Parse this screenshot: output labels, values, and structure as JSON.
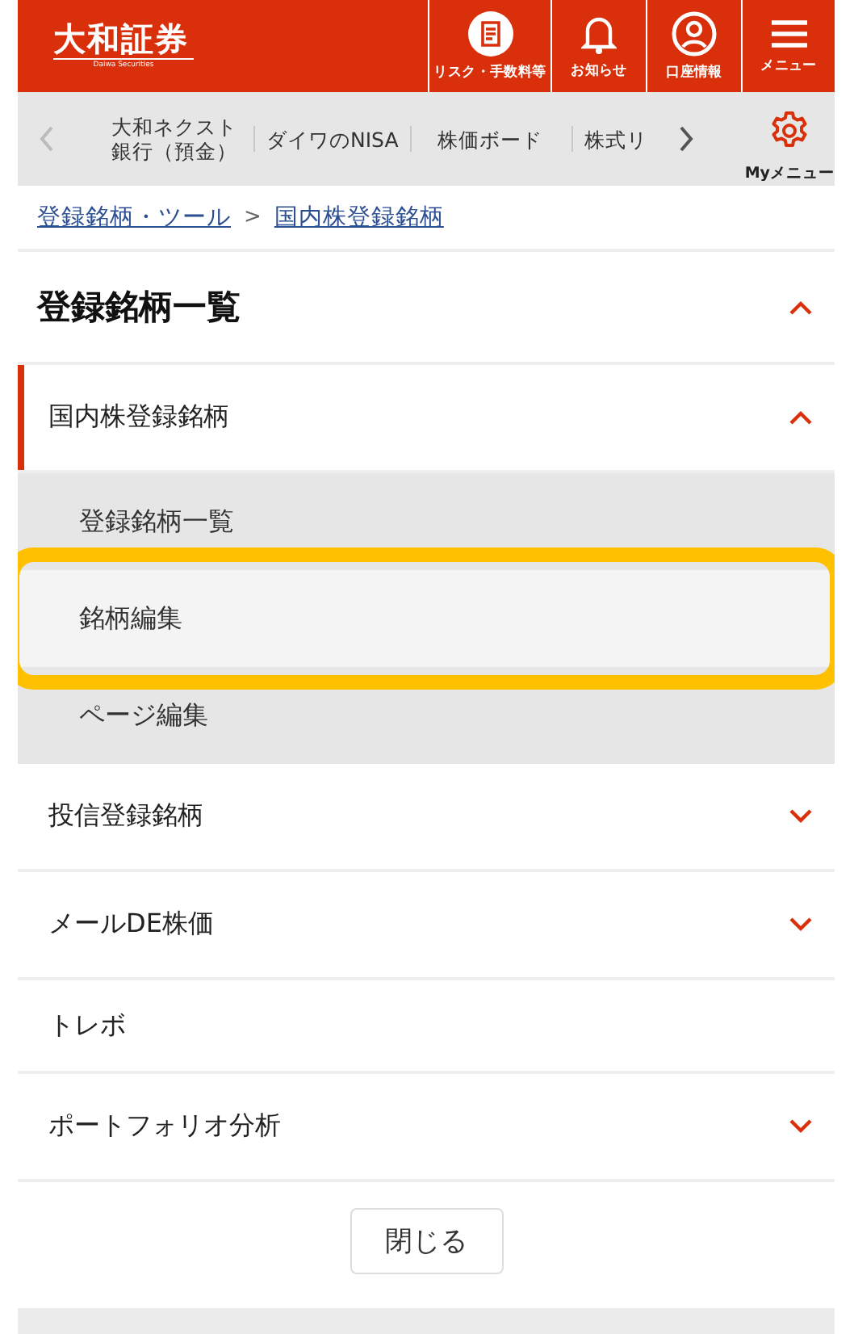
{
  "header": {
    "logo": "大和証券",
    "logo_sub": "Daiwa Securities",
    "actions": [
      {
        "kind": "document",
        "label": "リスク・手数料等"
      },
      {
        "kind": "bell",
        "label": "お知らせ"
      },
      {
        "kind": "user",
        "label": "口座情報"
      },
      {
        "kind": "menu",
        "label": "メニュー"
      }
    ]
  },
  "nav": {
    "items": [
      "大和ネクスト銀行（預金）",
      "ダイワのNISA",
      "株価ボード",
      "株式リ"
    ],
    "my_menu": "Myメニュー"
  },
  "breadcrumb": [
    "登録銘柄・ツール",
    "国内株登録銘柄"
  ],
  "breadcrumb_sep": ">",
  "section": {
    "title": "登録銘柄一覧",
    "expanded": true
  },
  "menu": [
    {
      "label": "国内株登録銘柄",
      "kind": "group",
      "expanded": true,
      "active": true,
      "children": [
        {
          "label": "登録銘柄一覧",
          "selected": false
        },
        {
          "label": "銘柄編集",
          "selected": true
        },
        {
          "label": "ページ編集",
          "selected": false
        }
      ]
    },
    {
      "label": "投信登録銘柄",
      "kind": "group",
      "expanded": false,
      "active": false
    },
    {
      "label": "メールDE株価",
      "kind": "group",
      "expanded": false,
      "active": false
    },
    {
      "label": "トレボ",
      "kind": "link",
      "active": false
    },
    {
      "label": "ポートフォリオ分析",
      "kind": "group",
      "expanded": false,
      "active": false
    }
  ],
  "close_button": "閉じる"
}
